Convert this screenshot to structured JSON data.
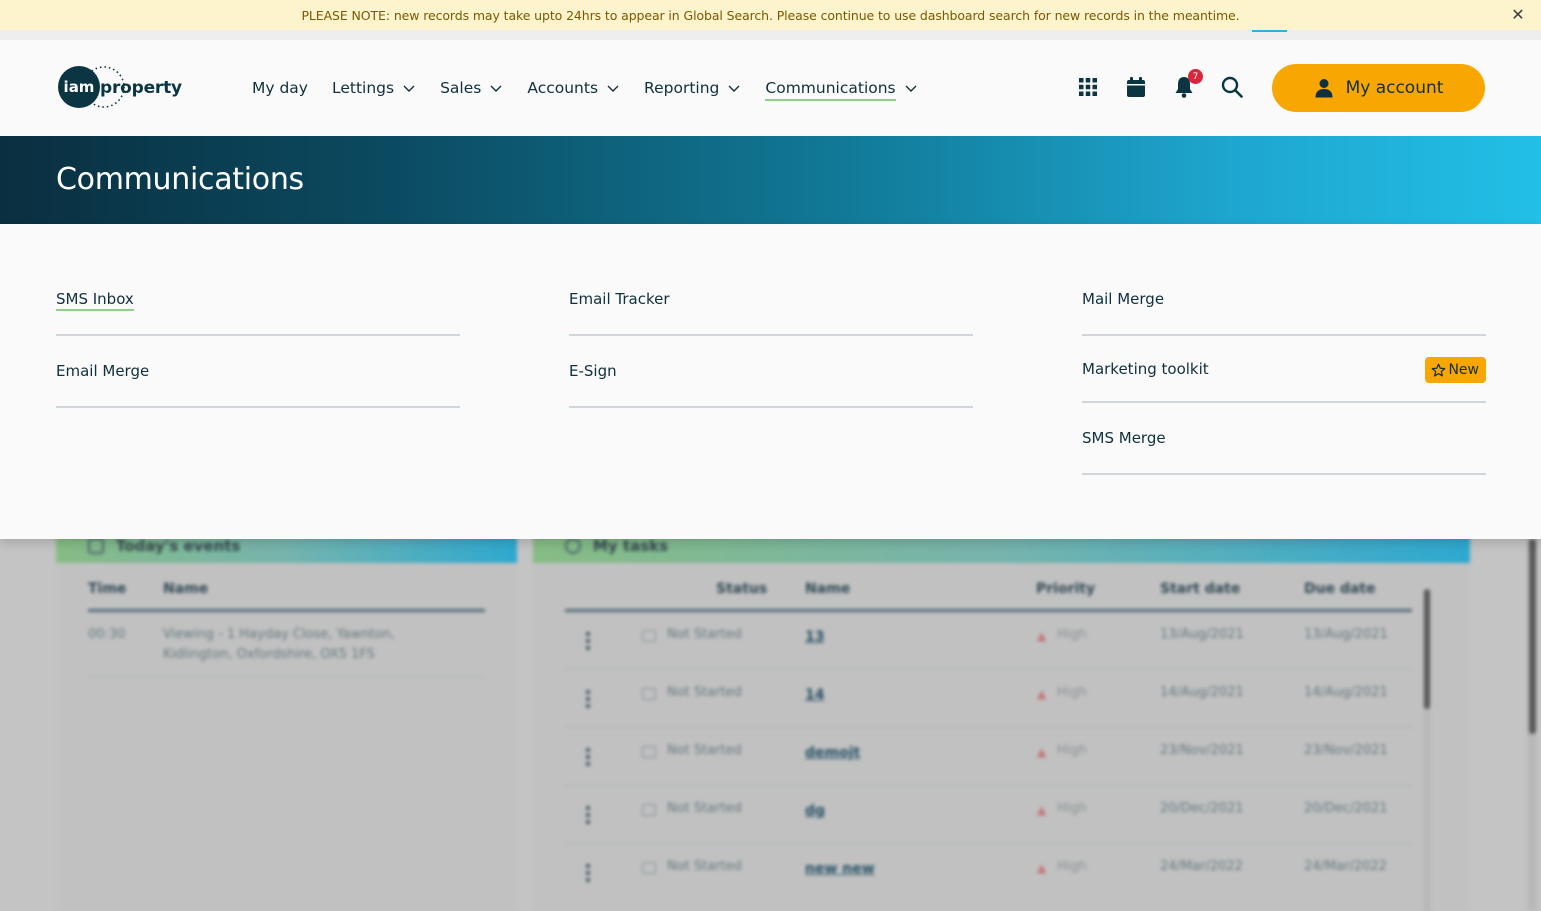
{
  "notice": {
    "text": "PLEASE NOTE: new records may take upto 24hrs to appear in Global Search. Please continue to use dashboard search for new records in the meantime.",
    "close_icon": "close-icon",
    "bg_color": "#fdf3cd"
  },
  "header": {
    "logo_iam": "iam",
    "logo_property": "property",
    "nav": [
      {
        "label": "My day",
        "has_dropdown": false
      },
      {
        "label": "Lettings",
        "has_dropdown": true
      },
      {
        "label": "Sales",
        "has_dropdown": true
      },
      {
        "label": "Accounts",
        "has_dropdown": true
      },
      {
        "label": "Reporting",
        "has_dropdown": true
      },
      {
        "label": "Communications",
        "has_dropdown": true,
        "active": true
      }
    ],
    "icons": [
      "apps-grid-icon",
      "calendar-icon",
      "bell-icon",
      "search-icon"
    ],
    "notification_count": "7",
    "account_label": "My account",
    "account_color": "#f8a602"
  },
  "banner": {
    "title": "Communications"
  },
  "menu": {
    "columns": [
      [
        {
          "label": "SMS Inbox",
          "current": true
        },
        {
          "label": "Email Merge"
        }
      ],
      [
        {
          "label": "Email Tracker"
        },
        {
          "label": "E-Sign"
        }
      ],
      [
        {
          "label": "Mail Merge"
        },
        {
          "label": "Marketing toolkit",
          "badge": "New"
        },
        {
          "label": "SMS Merge"
        }
      ]
    ]
  },
  "background": {
    "events": {
      "title": "Today's events",
      "columns": [
        "Time",
        "Name"
      ],
      "rows": [
        {
          "time": "00:30",
          "name_line1": "Viewing - 1 Hayday Close, Yawnton,",
          "name_line2": "Kidlington, Oxfordshire, OX5 1FS"
        }
      ]
    },
    "tasks": {
      "title": "My tasks",
      "columns": [
        "Status",
        "Name",
        "Priority",
        "Start date",
        "Due date"
      ],
      "rows": [
        {
          "status": "Not Started",
          "name": "13",
          "priority": "High",
          "start": "13/Aug/2021",
          "due": "13/Aug/2021"
        },
        {
          "status": "Not Started",
          "name": "14",
          "priority": "High",
          "start": "14/Aug/2021",
          "due": "14/Aug/2021"
        },
        {
          "status": "Not Started",
          "name": "demojt",
          "priority": "High",
          "start": "23/Nov/2021",
          "due": "23/Nov/2021"
        },
        {
          "status": "Not Started",
          "name": "dg",
          "priority": "High",
          "start": "20/Dec/2021",
          "due": "20/Dec/2021"
        },
        {
          "status": "Not Started",
          "name": "new new",
          "priority": "High",
          "start": "24/Mar/2022",
          "due": "24/Mar/2022"
        }
      ]
    }
  }
}
